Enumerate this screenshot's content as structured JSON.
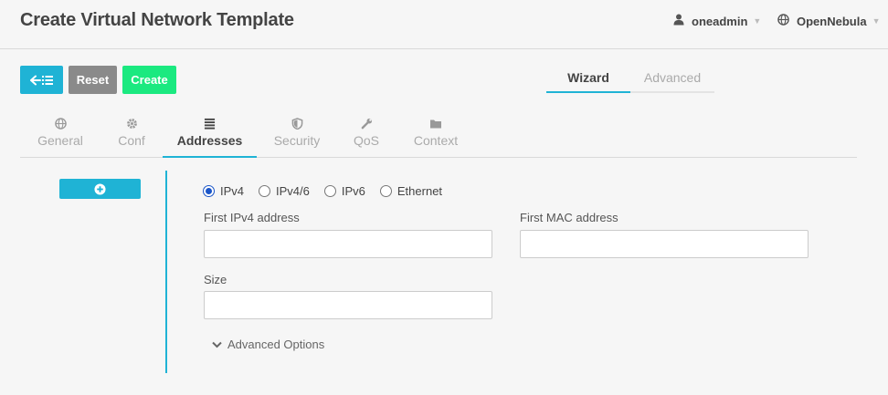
{
  "header": {
    "title": "Create Virtual Network Template",
    "user": {
      "name": "oneadmin",
      "icon": "user-icon"
    },
    "zone": {
      "name": "OpenNebula",
      "icon": "globe-icon"
    }
  },
  "toolbar": {
    "back_icon": "back-to-list-icon",
    "reset_label": "Reset",
    "create_label": "Create"
  },
  "mode_tabs": [
    {
      "label": "Wizard",
      "active": true
    },
    {
      "label": "Advanced",
      "active": false
    }
  ],
  "section_tabs": [
    {
      "label": "General",
      "icon": "globe-icon",
      "active": false
    },
    {
      "label": "Conf",
      "icon": "gear-icon",
      "active": false
    },
    {
      "label": "Addresses",
      "icon": "list-icon",
      "active": true
    },
    {
      "label": "Security",
      "icon": "shield-icon",
      "active": false
    },
    {
      "label": "QoS",
      "icon": "wrench-icon",
      "active": false
    },
    {
      "label": "Context",
      "icon": "folder-icon",
      "active": false
    }
  ],
  "address_range": {
    "add_icon": "plus-circle-icon",
    "types": [
      {
        "label": "IPv4",
        "checked": true
      },
      {
        "label": "IPv4/6",
        "checked": false
      },
      {
        "label": "IPv6",
        "checked": false
      },
      {
        "label": "Ethernet",
        "checked": false
      }
    ],
    "first_ipv4_label": "First IPv4 address",
    "first_ipv4_value": "",
    "first_mac_label": "First MAC address",
    "first_mac_value": "",
    "size_label": "Size",
    "size_value": "",
    "advanced_options_label": "Advanced Options"
  },
  "colors": {
    "accent": "#1fb3d5",
    "create": "#1be980",
    "reset": "#8a8a8a",
    "radio_checked": "#1a55c8"
  }
}
